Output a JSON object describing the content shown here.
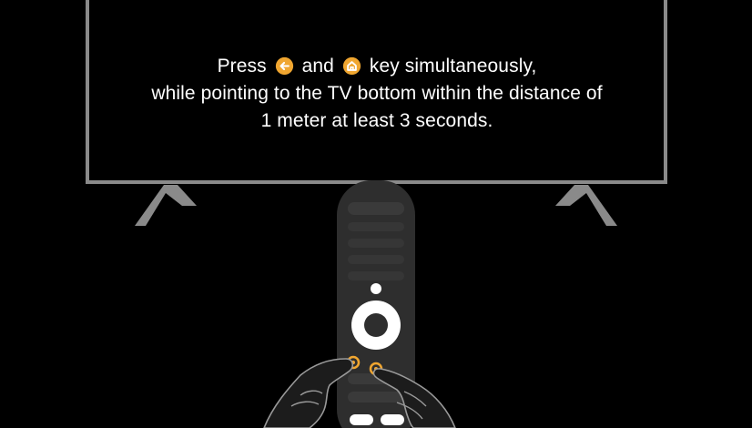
{
  "instruction": {
    "press_word": "Press",
    "and_word": "and",
    "line1_rest": "key simultaneously,",
    "line2": "while pointing to the TV bottom within the distance of",
    "line3": "1 meter at least 3 seconds."
  },
  "icons": {
    "first_key": "back-arrow-icon",
    "second_key": "home-icon"
  },
  "colors": {
    "background": "#000000",
    "tv_frame": "#8a8a8a",
    "accent": "#f0a630",
    "remote_body": "#2c2c2c",
    "text": "#ffffff"
  }
}
